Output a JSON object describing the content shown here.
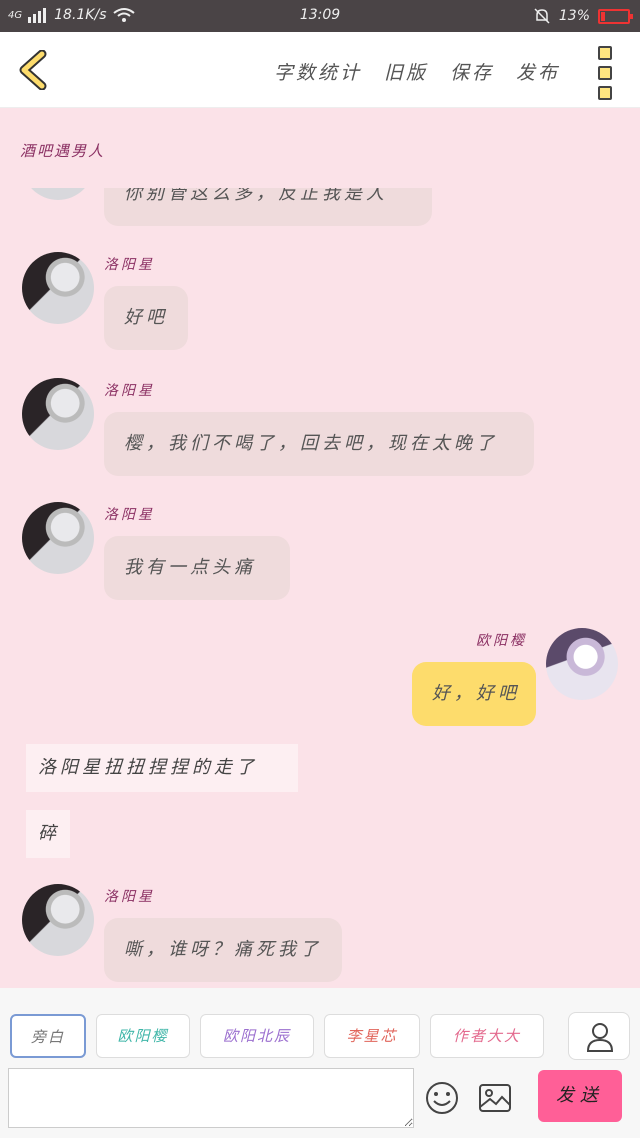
{
  "status": {
    "network": "4G",
    "speed": "18.1K/s",
    "time": "13:09",
    "battery": "13%",
    "battery_level": 0.13
  },
  "header": {
    "nav": [
      "字数统计",
      "旧版",
      "保存",
      "发布"
    ]
  },
  "title": "酒吧遇男人",
  "messages": {
    "partial": "你别管这么多，反正我是人",
    "m1": {
      "name": "洛阳星",
      "text": "好吧"
    },
    "m2": {
      "name": "洛阳星",
      "text": "樱，我们不喝了，回去吧，现在太晚了"
    },
    "m3": {
      "name": "洛阳星",
      "text": "我有一点头痛"
    },
    "m4": {
      "name": "欧阳樱",
      "text": "好，好吧"
    },
    "n1": "洛阳星扭扭捏捏的走了",
    "n2": "碎",
    "m5": {
      "name": "洛阳星",
      "text": "嘶，谁呀？痛死我了"
    }
  },
  "characters": [
    {
      "label": "旁白",
      "color": "#777777"
    },
    {
      "label": "欧阳樱",
      "color": "#3fb6a8"
    },
    {
      "label": "欧阳北辰",
      "color": "#9b6fcf"
    },
    {
      "label": "李星芯",
      "color": "#e1665c"
    },
    {
      "label": "作者大大",
      "color": "#e36a8e"
    }
  ],
  "input": {
    "placeholder": ""
  },
  "send_label": "发送"
}
